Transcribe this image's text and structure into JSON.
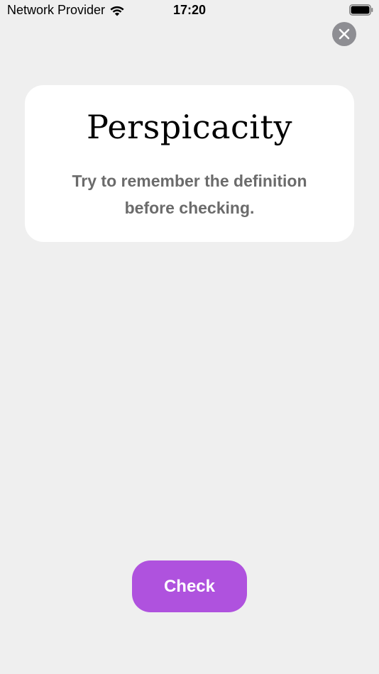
{
  "status_bar": {
    "carrier": "Network Provider",
    "time": "17:20",
    "wifi_icon": "wifi-icon",
    "battery_icon": "battery-icon"
  },
  "close_button": {
    "icon": "close-icon"
  },
  "card": {
    "word": "Perspicacity",
    "hint": "Try to remember the definition before checking."
  },
  "check_button": {
    "label": "Check"
  },
  "colors": {
    "background": "#efefef",
    "card": "#ffffff",
    "accent": "#af52de",
    "close_button": "#8e8e93",
    "hint_text": "#6b6b6b"
  }
}
